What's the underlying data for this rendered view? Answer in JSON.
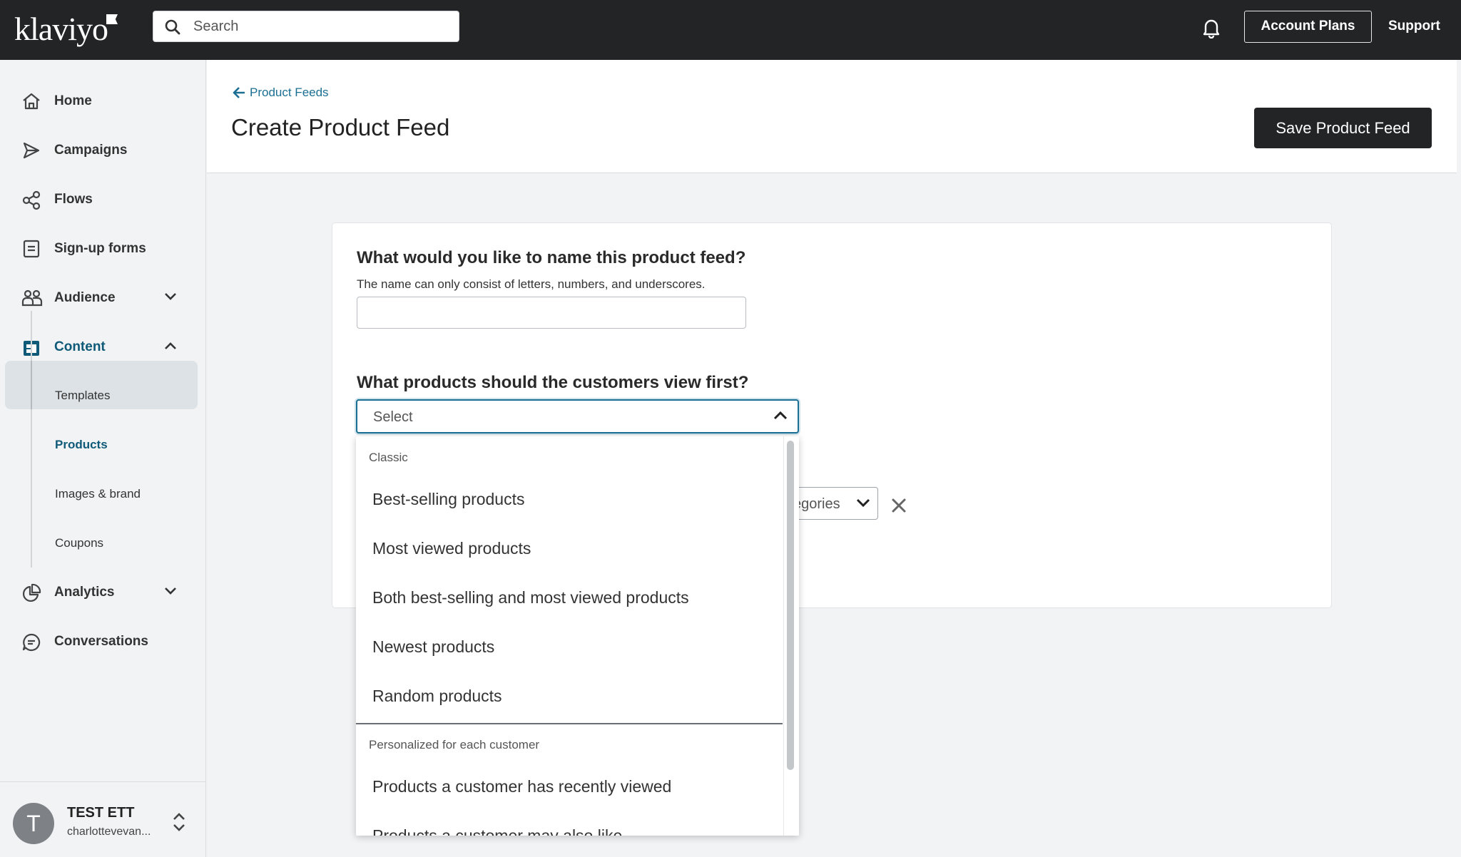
{
  "topbar": {
    "logo_text": "klaviyo",
    "search_placeholder": "Search",
    "account_plans_label": "Account Plans",
    "support_label": "Support"
  },
  "sidebar": {
    "items": [
      {
        "label": "Home",
        "icon": "home-icon"
      },
      {
        "label": "Campaigns",
        "icon": "send-icon"
      },
      {
        "label": "Flows",
        "icon": "flows-icon"
      },
      {
        "label": "Sign-up forms",
        "icon": "form-icon"
      },
      {
        "label": "Audience",
        "icon": "users-icon"
      },
      {
        "label": "Content",
        "icon": "content-icon"
      },
      {
        "label": "Analytics",
        "icon": "chart-pie-icon"
      },
      {
        "label": "Conversations",
        "icon": "chat-icon"
      }
    ],
    "content_subitems": [
      "Templates",
      "Products",
      "Images & brand",
      "Coupons"
    ],
    "active_subitem": "Products",
    "user": {
      "initial": "T",
      "name": "TEST ETT",
      "email": "charlottevevan..."
    }
  },
  "header": {
    "back_label": "Product Feeds",
    "title": "Create Product Feed",
    "save_label": "Save Product Feed"
  },
  "form": {
    "name_question": "What would you like to name this product feed?",
    "name_hint": "The name can only consist of letters, numbers, and underscores.",
    "name_value": "",
    "products_question": "What products should the customers view first?",
    "select_value": "Select",
    "category_select_value": "egories"
  },
  "dropdown": {
    "groups": [
      {
        "label": "Classic",
        "options": [
          "Best-selling products",
          "Most viewed products",
          "Both best-selling and most viewed products",
          "Newest products",
          "Random products"
        ]
      },
      {
        "label": "Personalized for each customer",
        "options": [
          "Products a customer has recently viewed",
          "Products a customer may also like"
        ]
      }
    ]
  },
  "colors": {
    "topbar_bg": "#232426",
    "accent": "#1b6f93",
    "active_nav": "#0f5a78"
  }
}
